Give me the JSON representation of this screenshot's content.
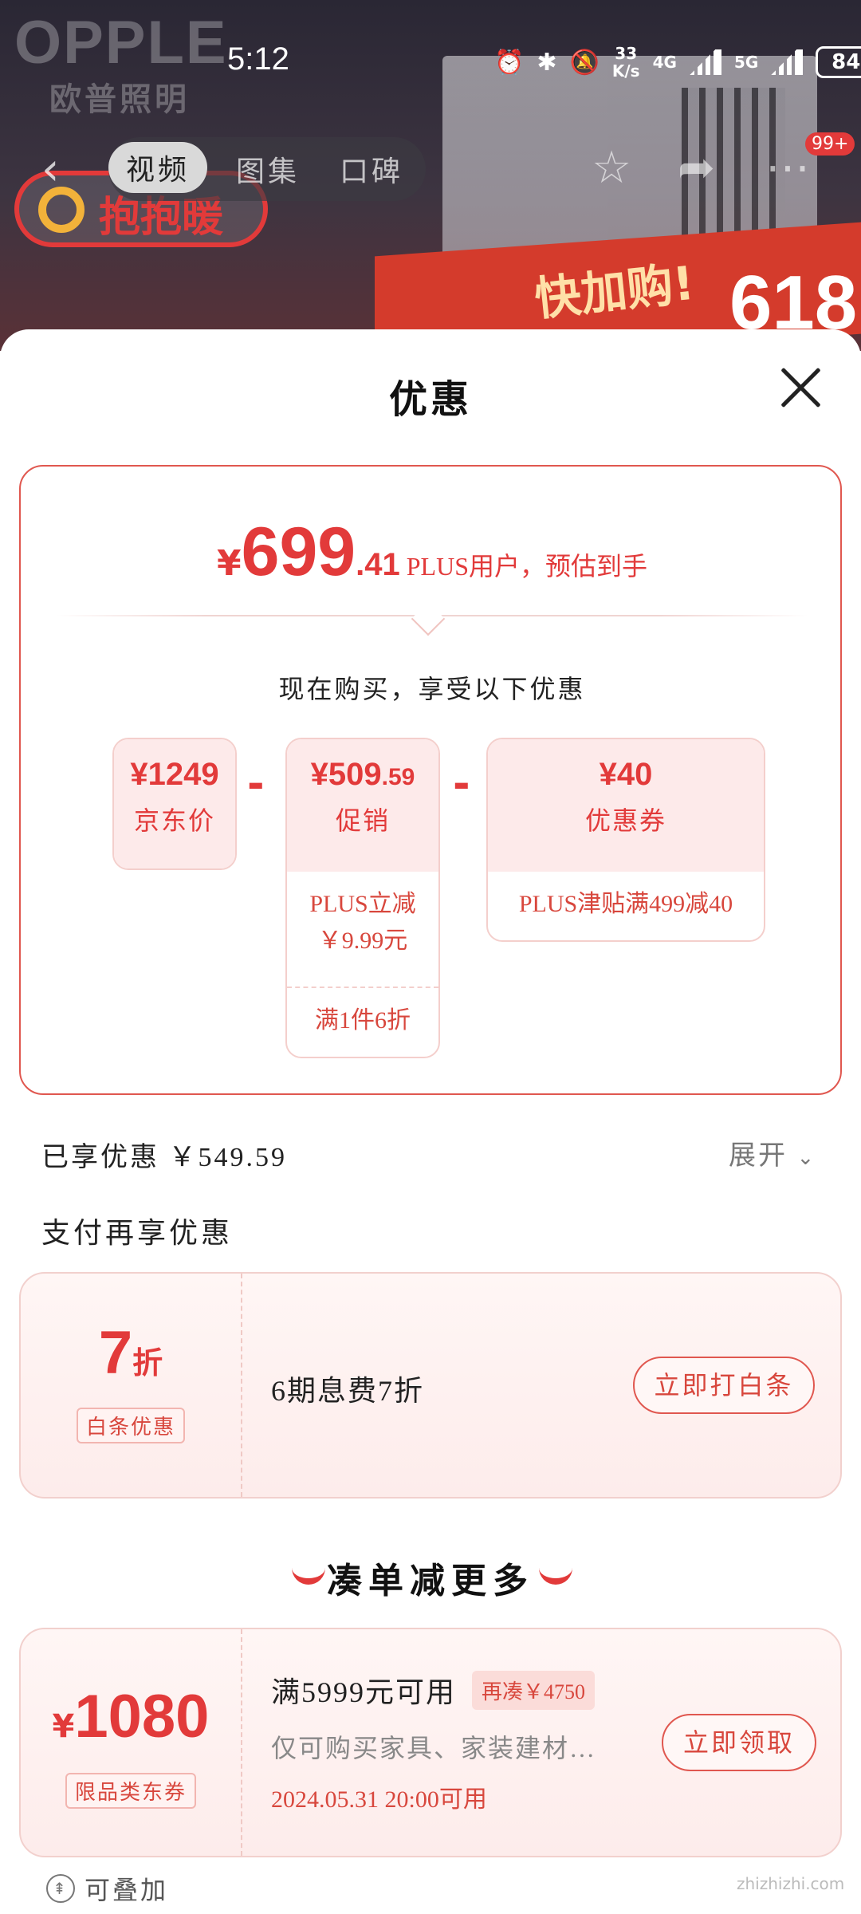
{
  "status_bar": {
    "time": "5:12",
    "net_speed_top": "33",
    "net_speed_bottom": "K/s",
    "net_4g": "4G",
    "net_5g": "5G",
    "battery": "84"
  },
  "banner": {
    "brand": "OPPLE",
    "brand_sub": "欧普照明",
    "promo_pill": "抱抱暖",
    "hurry": "快加购!",
    "event": "618",
    "accent_color": "#e23a3a"
  },
  "nav": {
    "tabs": [
      {
        "label": "视频",
        "active": true
      },
      {
        "label": "图集",
        "active": false
      },
      {
        "label": "口碑",
        "active": false
      }
    ],
    "message_badge": "99+"
  },
  "sheet": {
    "title": "优惠",
    "final_price": {
      "currency": "¥",
      "integer": "699",
      "decimal": ".41",
      "note": "PLUS用户，预估到手"
    },
    "now_buy_text": "现在购买，享受以下优惠",
    "breakdown": {
      "jd_price": {
        "amount": "¥1249",
        "label": "京东价"
      },
      "promo": {
        "amount_main": "¥509",
        "amount_dec": ".59",
        "label": "促销",
        "lines": [
          "PLUS立减\n￥9.99元",
          "满1件6折"
        ]
      },
      "coupon": {
        "amount": "¥40",
        "label": "优惠券",
        "lines": [
          "PLUS津贴满499减40"
        ]
      },
      "minus_sign": "-"
    },
    "enjoyed": "已享优惠  ￥549.59",
    "expand": "展开",
    "pay_title": "支付再享优惠",
    "baitiao": {
      "discount_num": "7",
      "discount_unit": "折",
      "tag": "白条优惠",
      "desc": "6期息费7折",
      "button": "立即打白条"
    },
    "more_title": "凑单减更多",
    "big_coupon": {
      "currency": "¥",
      "amount": "1080",
      "tag": "限品类东券",
      "condition": "满5999元可用",
      "extra_tag": "再凑￥4750",
      "scope": "仅可购买家具、家装建材…",
      "time": "2024.05.31  20:00可用",
      "button": "立即领取"
    },
    "stackable": "可叠加"
  },
  "watermark": "zhizhizhi.com"
}
